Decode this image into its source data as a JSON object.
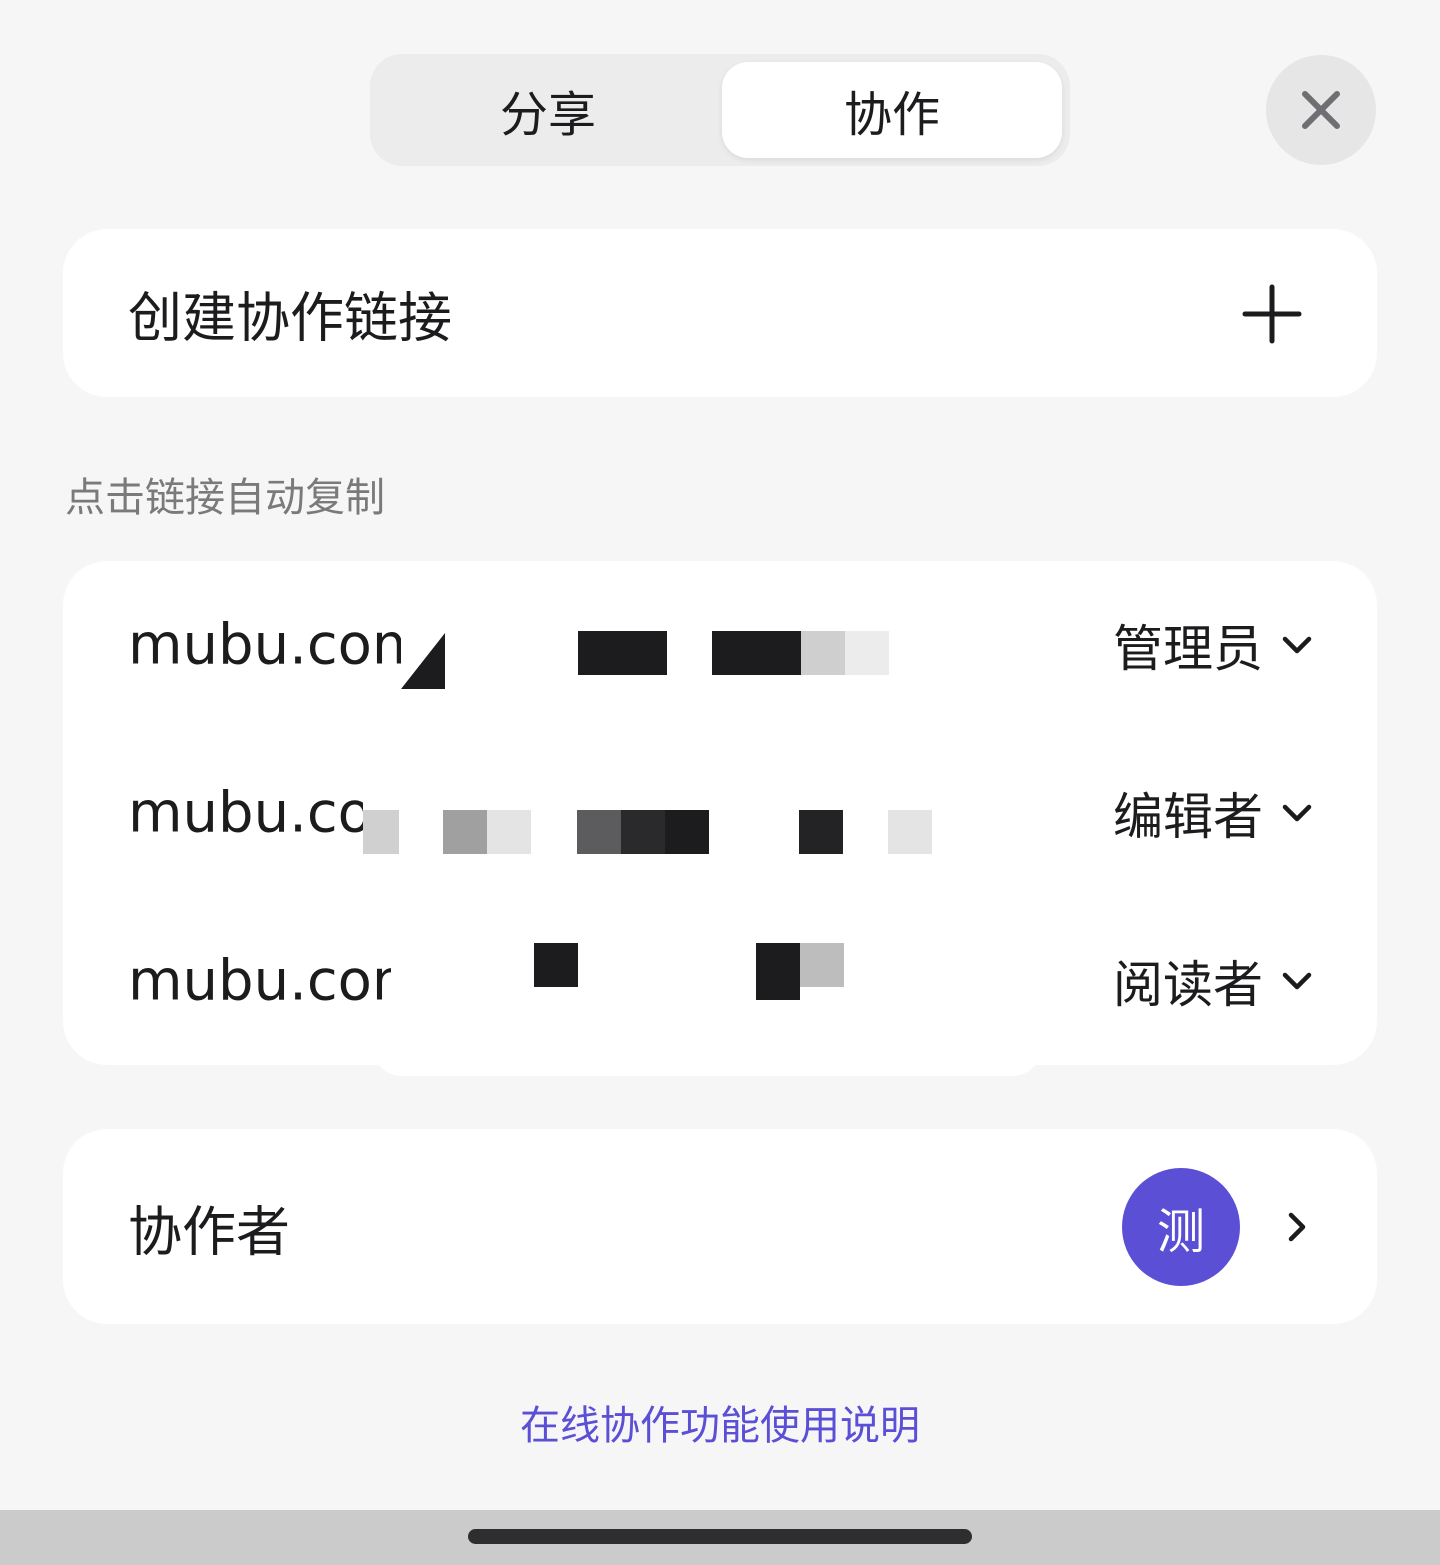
{
  "tabs": {
    "share_label": "分享",
    "collab_label": "协作",
    "active": "协作"
  },
  "create": {
    "label": "创建协作链接"
  },
  "hint": "点击链接自动复制",
  "links": [
    {
      "url": "mubu.com/",
      "role": "管理员"
    },
    {
      "url": "mubu.com",
      "role": "编辑者"
    },
    {
      "url": "mubu.com",
      "role": "阅读者"
    }
  ],
  "collaborators": {
    "label": "协作者",
    "avatar_text": "测"
  },
  "help_link": "在线协作功能使用说明",
  "colors": {
    "accent": "#5b4fd6",
    "background": "#f6f6f6",
    "card": "#ffffff"
  }
}
